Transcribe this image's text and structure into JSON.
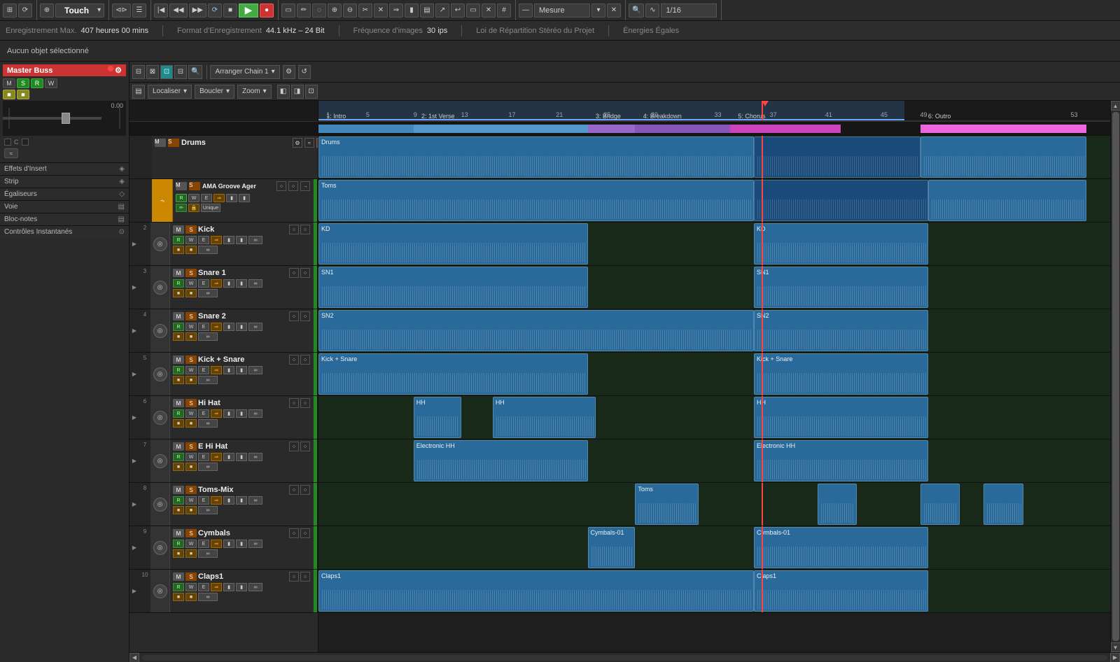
{
  "toolbar": {
    "title": "Touch",
    "transport": {
      "rewind": "⏮",
      "back": "◀",
      "forward": "▶▶",
      "stop": "■",
      "play": "▶",
      "record": "●"
    },
    "measure_label": "Mesure",
    "quantize_label": "1/16"
  },
  "infobar": {
    "recording_label": "Enregistrement Max.",
    "recording_value": "407 heures 00 mins",
    "format_label": "Format d'Enregistrement",
    "format_value": "44.1 kHz – 24 Bit",
    "fps_label": "Fréquence d'images",
    "fps_value": "30 ips",
    "stereo_label": "Loi de Répartition Stéréo du Projet",
    "energy_label": "Énergies Égales"
  },
  "noselect": "Aucun objet sélectionné",
  "master_buss": {
    "label": "Master Buss",
    "value": "0.00",
    "channel_label": "C"
  },
  "arranger": {
    "chain_label": "Arranger Chain 1",
    "localize_label": "Localiser",
    "loop_label": "Boucler",
    "zoom_label": "Zoom"
  },
  "side_sections": [
    {
      "label": "Effets d'Insert",
      "icon": "◈"
    },
    {
      "label": "Strip",
      "icon": "◈"
    },
    {
      "label": "Égaliseurs",
      "icon": "◇"
    },
    {
      "label": "Voie",
      "icon": "▤"
    },
    {
      "label": "Bloc-notes",
      "icon": "▤"
    },
    {
      "label": "Contrôles Instantanés",
      "icon": "⊙"
    }
  ],
  "timeline": {
    "playhead_pct": 56,
    "ruler_marks": [
      1,
      5,
      9,
      13,
      17,
      21,
      25,
      29,
      33,
      37,
      41,
      45,
      49,
      53
    ],
    "sections": [
      {
        "label": "1: Intro",
        "left_pct": 0,
        "width_pct": 12,
        "color": "#4488bb"
      },
      {
        "label": "2: 1st Verse",
        "left_pct": 12,
        "width_pct": 22,
        "color": "#5599cc"
      },
      {
        "label": "3: Bridge",
        "left_pct": 34,
        "width_pct": 6,
        "color": "#9966cc"
      },
      {
        "label": "4: Breakdown",
        "left_pct": 40,
        "width_pct": 12,
        "color": "#8855bb"
      },
      {
        "label": "5: Chorus",
        "left_pct": 52,
        "width_pct": 14,
        "color": "#cc44bb"
      },
      {
        "label": "6: Outro",
        "left_pct": 76,
        "width_pct": 24,
        "color": "#dd55cc"
      }
    ]
  },
  "tracks": [
    {
      "num": "",
      "name": "Drums",
      "type": "drums",
      "color": "#3a8aba",
      "clips": [
        {
          "label": "Drums",
          "left_pct": 0,
          "width_pct": 55,
          "color": "#2a6a9a"
        },
        {
          "label": "",
          "left_pct": 55,
          "width_pct": 21,
          "color": "#2a6a9a"
        },
        {
          "label": "",
          "left_pct": 76,
          "width_pct": 24,
          "color": "#2a6a9a"
        }
      ]
    },
    {
      "num": "",
      "name": "AMA Groove Ager",
      "type": "instrument",
      "color": "#cc8800",
      "clips": [
        {
          "label": "Toms",
          "left_pct": 0,
          "width_pct": 55,
          "color": "#2a7aaa"
        },
        {
          "label": "",
          "left_pct": 55,
          "width_pct": 22,
          "color": "#2a7aaa"
        },
        {
          "label": "",
          "left_pct": 76,
          "width_pct": 24,
          "color": "#2a7aaa"
        }
      ]
    },
    {
      "num": "2",
      "name": "Kick",
      "type": "audio",
      "clips": [
        {
          "label": "KD",
          "left_pct": 0,
          "width_pct": 34,
          "color": "#2a6a9a"
        },
        {
          "label": "KD",
          "left_pct": 55,
          "width_pct": 21,
          "color": "#2a6a9a"
        }
      ]
    },
    {
      "num": "3",
      "name": "Snare 1",
      "type": "audio",
      "clips": [
        {
          "label": "SN1",
          "left_pct": 0,
          "width_pct": 34,
          "color": "#2a6a9a"
        },
        {
          "label": "SN1",
          "left_pct": 55,
          "width_pct": 21,
          "color": "#2a6a9a"
        }
      ]
    },
    {
      "num": "4",
      "name": "Snare 2",
      "type": "audio",
      "clips": [
        {
          "label": "SN2",
          "left_pct": 0,
          "width_pct": 55,
          "color": "#2a6a9a"
        },
        {
          "label": "SN2",
          "left_pct": 55,
          "width_pct": 21,
          "color": "#2a6a9a"
        }
      ]
    },
    {
      "num": "5",
      "name": "Kick + Snare",
      "type": "audio",
      "clips": [
        {
          "label": "Kick + Snare",
          "left_pct": 0,
          "width_pct": 34,
          "color": "#2a6a9a"
        },
        {
          "label": "Kick + Snare",
          "left_pct": 55,
          "width_pct": 21,
          "color": "#2a6a9a"
        }
      ]
    },
    {
      "num": "6",
      "name": "Hi Hat",
      "type": "audio",
      "clips": [
        {
          "label": "HH",
          "left_pct": 12,
          "width_pct": 6,
          "color": "#2a6a9a"
        },
        {
          "label": "HH",
          "left_pct": 22,
          "width_pct": 12,
          "color": "#2a6a9a"
        },
        {
          "label": "HH",
          "left_pct": 55,
          "width_pct": 21,
          "color": "#2a6a9a"
        }
      ]
    },
    {
      "num": "7",
      "name": "E Hi Hat",
      "type": "audio",
      "clips": [
        {
          "label": "Electronic HH",
          "left_pct": 12,
          "width_pct": 22,
          "color": "#2a6a9a"
        },
        {
          "label": "Electronic HH",
          "left_pct": 55,
          "width_pct": 21,
          "color": "#2a6a9a"
        }
      ]
    },
    {
      "num": "8",
      "name": "Toms-Mix",
      "type": "audio",
      "clips": [
        {
          "label": "Toms",
          "left_pct": 40,
          "width_pct": 8,
          "color": "#2a6a9a"
        },
        {
          "label": "",
          "left_pct": 63,
          "width_pct": 5,
          "color": "#2a6a9a"
        },
        {
          "label": "",
          "left_pct": 76,
          "width_pct": 5,
          "color": "#2a6a9a"
        },
        {
          "label": "",
          "left_pct": 84,
          "width_pct": 5,
          "color": "#2a6a9a"
        }
      ]
    },
    {
      "num": "9",
      "name": "Cymbals",
      "type": "audio",
      "clips": [
        {
          "label": "Cymbals-01",
          "left_pct": 34,
          "width_pct": 6,
          "color": "#2a6a9a"
        },
        {
          "label": "Cymbals-01",
          "left_pct": 55,
          "width_pct": 21,
          "color": "#2a6a9a"
        }
      ]
    },
    {
      "num": "10",
      "name": "Claps1",
      "type": "audio",
      "clips": [
        {
          "label": "Claps1",
          "left_pct": 0,
          "width_pct": 55,
          "color": "#2a6a9a"
        },
        {
          "label": "Claps1",
          "left_pct": 55,
          "width_pct": 21,
          "color": "#2a6a9a"
        }
      ]
    }
  ],
  "buttons": {
    "m": "M",
    "s": "S",
    "r": "R",
    "w": "W",
    "e": "E",
    "lock": "🔒",
    "eq": "≡"
  }
}
